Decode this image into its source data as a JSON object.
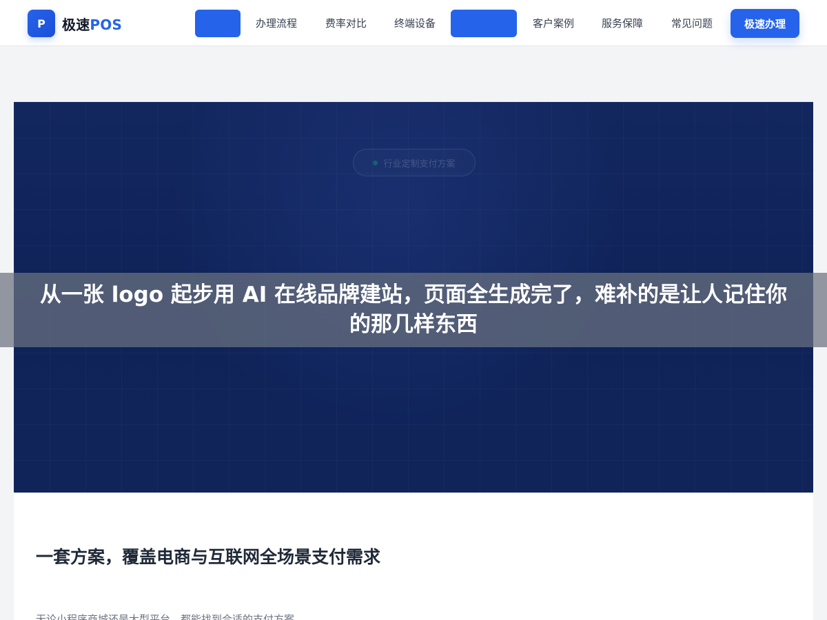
{
  "brand": {
    "logo_mark": "P",
    "name_prefix": "极速",
    "name_suffix": "POS",
    "colors": {
      "primary": "#2563eb",
      "dark_navy": "#13275f"
    }
  },
  "nav": {
    "items": [
      {
        "label": ""
      },
      {
        "label": "办理流程"
      },
      {
        "label": "费率对比"
      },
      {
        "label": "终端设备"
      },
      {
        "label": ""
      },
      {
        "label": "客户案例"
      },
      {
        "label": "服务保障"
      },
      {
        "label": "常见问题"
      }
    ],
    "cta_label": "极速办理"
  },
  "hero": {
    "badge": "行业定制支付方案"
  },
  "overlay": {
    "title": "从一张 logo 起步用 AI 在线品牌建站，页面全生成完了，难补的是让人记住你的那几样东西"
  },
  "section": {
    "title": "一套方案，覆盖电商与互联网全场景支付需求",
    "subtitle": "无论小程序商城还是大型平台，都能找到合适的支付方案"
  }
}
